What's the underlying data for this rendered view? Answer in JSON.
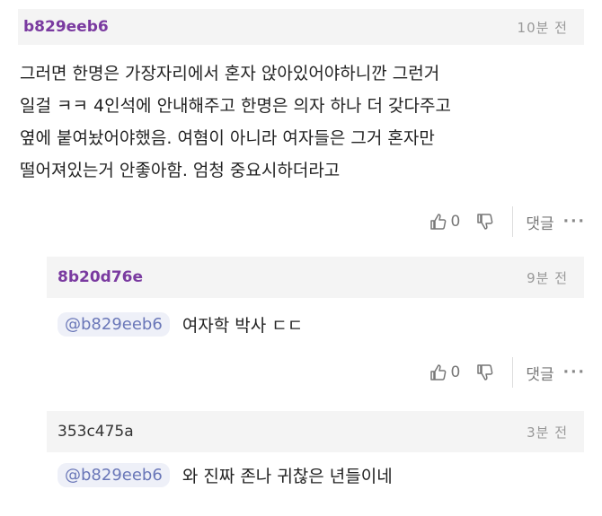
{
  "comments": [
    {
      "author": "b829eeb6",
      "time": "10분 전",
      "lines": [
        "그러면 한명은 가장자리에서 혼자 앉아있어야하니깐 그런거",
        "일걸 ㅋㅋ 4인석에 안내해주고 한명은 의자 하나 더 갖다주고",
        "옆에 붙여놨어야했음. 여혐이 아니라 여자들은 그거 혼자만",
        "떨어져있는거 안좋아함. 엄청 중요시하더라고"
      ],
      "likes": "0",
      "reply_label": "댓글",
      "more": "···"
    },
    {
      "author": "8b20d76e",
      "time": "9분 전",
      "mention": "@b829eeb6",
      "text": "여자학 박사 ㄷㄷ",
      "likes": "0",
      "reply_label": "댓글",
      "more": "···"
    },
    {
      "author": "353c475a",
      "time": "3분 전",
      "mention": "@b829eeb6",
      "text": "와 진짜 존나 귀찮은 년들이네"
    }
  ],
  "colors": {
    "author_purple": "#7a3aa0",
    "mention_blue": "#6a77b8",
    "header_bg": "#f4f4f4"
  },
  "icons": [
    "thumbs-up-icon",
    "thumbs-down-icon",
    "more-icon"
  ]
}
